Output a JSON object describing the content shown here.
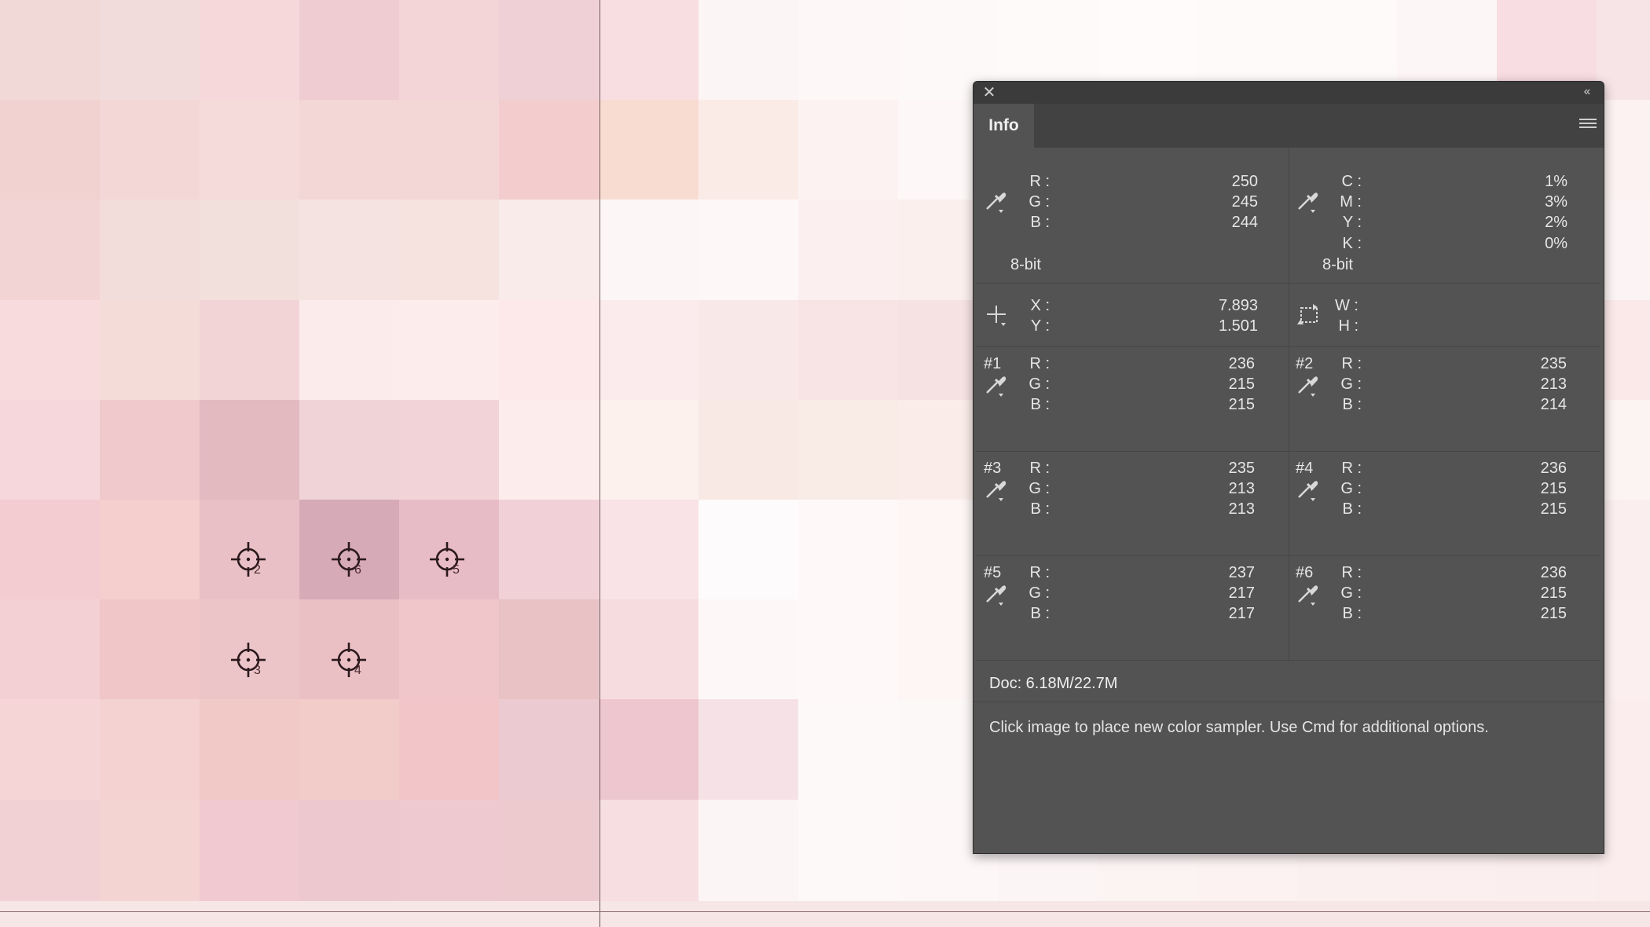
{
  "canvas": {
    "grid_cols": [
      "#efd7d3",
      "#f1d8d9",
      "#f6d6d8",
      "#efcbd1",
      "#f3d4d7",
      "#efd0d6",
      "#f8dde1",
      "#fcf6f6",
      "#fdf7f6",
      "#fcf8f7",
      "#fdf9f8",
      "#fdfafa",
      "#fdfaf8",
      "#fdfafa",
      "#fdf7f7",
      "#f8dee2",
      "#f6e3e6"
    ],
    "rows": [
      [
        "#f0d9d6",
        "#f2dbdb",
        "#f6d8da",
        "#efccd2",
        "#f3d5d8",
        "#efd0d6",
        "#f8dde1",
        "#fbf5f5",
        "#fdf8f7",
        "#fdf9f8",
        "#fdfaf9",
        "#fefbfa",
        "#fdfaf9",
        "#fdfaf9",
        "#fdf6f7",
        "#f8dde2",
        "#f7e4e6"
      ],
      [
        "#f2d2d1",
        "#f3d7d6",
        "#f5dcdb",
        "#f3d6d6",
        "#f3d6d6",
        "#f3cdce",
        "#f8dcd2",
        "#fbebe7",
        "#fbf2f1",
        "#fdf8f7",
        "#fbf2f1",
        "#fcf6f4",
        "#fdf8f7",
        "#fcf6f5",
        "#fbf5f5",
        "#faeeed",
        "#fcf2f2"
      ],
      [
        "#f2d4d4",
        "#f2dddb",
        "#f2e0dd",
        "#f4e3e0",
        "#f6e2df",
        "#f8ebe9",
        "#fcf7f6",
        "#fdf8f7",
        "#fbefef",
        "#fbefee",
        "#fbf1f0",
        "#fcf4f4",
        "#fcf4f3",
        "#fbf3f3",
        "#fdf8f7",
        "#fcf5f5",
        "#fcf4f4"
      ],
      [
        "#f7dbdd",
        "#f4dcd9",
        "#f3d4d6",
        "#fbeceb",
        "#fcecec",
        "#fde9e9",
        "#fbebec",
        "#f8e8e7",
        "#f8e4e4",
        "#f6e2e2",
        "#f6e6e6",
        "#fbf0f0",
        "#fbf2f2",
        "#fcf5f5",
        "#fdf8f8",
        "#fcebec",
        "#fbe9ea"
      ],
      [
        "#f6d7db",
        "#efc9cc",
        "#e2bac0",
        "#f0d3d7",
        "#f2d4d8",
        "#fcecec",
        "#fcf1ed",
        "#f9e9e4",
        "#f9ebe6",
        "#faede9",
        "#fbf1ef",
        "#fcf4f3",
        "#fdf7f6",
        "#fdf7f7",
        "#fcf5f5",
        "#fcf2f2",
        "#fcf3f3"
      ],
      [
        "#f3ccd1",
        "#f5cece",
        "#e9c0c5",
        "#d7aab8",
        "#e8bcc7",
        "#f1d0d7",
        "#f9e3e6",
        "#fdfbfb",
        "#fef9f8",
        "#fdf6f5",
        "#fdf6f5",
        "#fdf5f4",
        "#fdf5f4",
        "#fcf3f3",
        "#fcf2f2",
        "#fbf0f0",
        "#fbeeee"
      ],
      [
        "#f3d0d4",
        "#f0c6c9",
        "#ecc5c9",
        "#ebc0c5",
        "#f0c6ca",
        "#e8c2c4",
        "#f6dcdf",
        "#fdf8f7",
        "#fef9f8",
        "#fdf6f5",
        "#fdf5f5",
        "#fdf5f4",
        "#fcf3f3",
        "#fcf3f3",
        "#fcf2f2",
        "#fcf1f1",
        "#fbefef"
      ],
      [
        "#f5d5d6",
        "#f3d2d1",
        "#f1c9c6",
        "#f1ccc9",
        "#f2c6c8",
        "#ebcbd1",
        "#edc6cf",
        "#f6e2e6",
        "#fdf9f9",
        "#fdf8f8",
        "#fdf6f6",
        "#fcf4f4",
        "#fcf3f3",
        "#fcf2f2",
        "#fbf0f0",
        "#fbeeee",
        "#fbeded"
      ],
      [
        "#f2d1d5",
        "#f4d3d3",
        "#f1c9d0",
        "#edc8cf",
        "#eecad0",
        "#eccacd",
        "#f6dee1",
        "#fcf5f5",
        "#fdf9f8",
        "#fdf7f7",
        "#fcf5f5",
        "#fcf3f3",
        "#fcf2f2",
        "#fbf0f0",
        "#fbefef",
        "#fbeeee",
        "#fbedee"
      ]
    ],
    "samplers": [
      {
        "id": "2",
        "label": "2"
      },
      {
        "id": "6",
        "label": "6"
      },
      {
        "id": "5",
        "label": "5"
      },
      {
        "id": "3",
        "label": "3"
      },
      {
        "id": "4",
        "label": "4"
      }
    ]
  },
  "panel": {
    "close_glyph": "✕",
    "collapse_glyph": "‹‹",
    "tab_label": "Info",
    "rgb": {
      "r_label": "R :",
      "g_label": "G :",
      "b_label": "B :",
      "r": "250",
      "g": "245",
      "b": "244",
      "bits": "8-bit"
    },
    "cmyk": {
      "c_label": "C :",
      "m_label": "M :",
      "y_label": "Y :",
      "k_label": "K :",
      "c": "1%",
      "m": "3%",
      "y": "2%",
      "k": "0%",
      "bits": "8-bit"
    },
    "position": {
      "x_label": "X :",
      "y_label": "Y :",
      "x": "7.893",
      "y": "1.501"
    },
    "size": {
      "w_label": "W :",
      "h_label": "H :"
    },
    "samples": [
      {
        "tag": "#1",
        "r": "236",
        "g": "215",
        "b": "215"
      },
      {
        "tag": "#2",
        "r": "235",
        "g": "213",
        "b": "214"
      },
      {
        "tag": "#3",
        "r": "235",
        "g": "213",
        "b": "213"
      },
      {
        "tag": "#4",
        "r": "236",
        "g": "215",
        "b": "215"
      },
      {
        "tag": "#5",
        "r": "237",
        "g": "217",
        "b": "217"
      },
      {
        "tag": "#6",
        "r": "236",
        "g": "215",
        "b": "215"
      }
    ],
    "doc": "Doc: 6.18M/22.7M",
    "hint": "Click image to place new color sampler.  Use Cmd for additional options."
  },
  "icons": {
    "eyedropper": "eyedropper-icon",
    "crosshair": "crosshair-icon",
    "selection": "selection-size-icon",
    "sampler": "color-sampler-icon",
    "menu": "panel-menu-icon"
  }
}
